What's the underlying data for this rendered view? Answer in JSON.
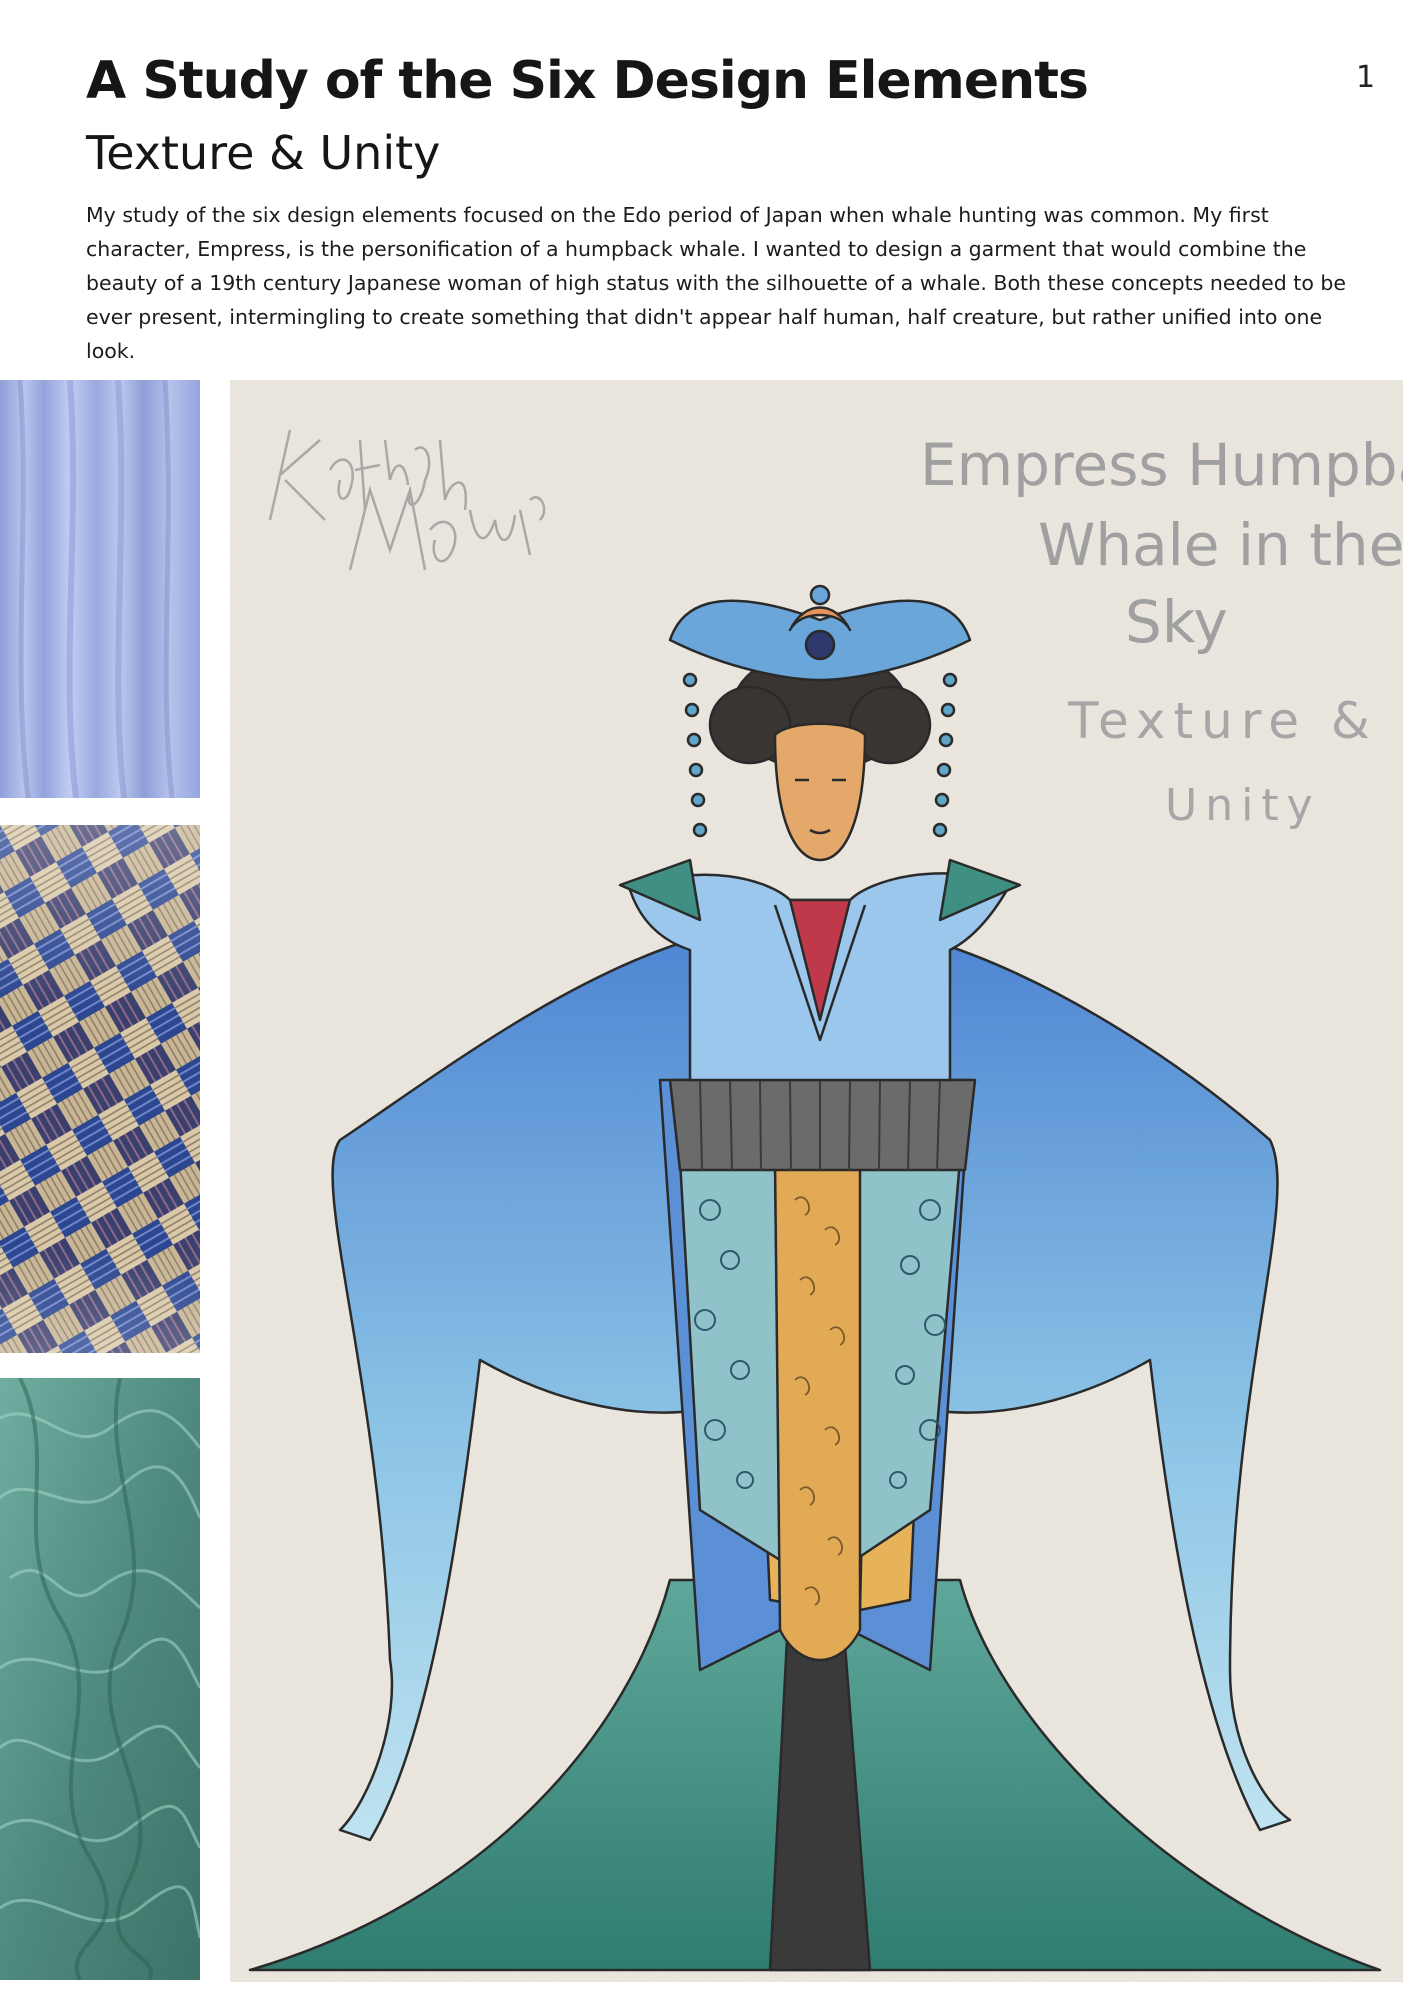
{
  "header": {
    "title": "A Study of the Six Design Elements",
    "subtitle": "Texture & Unity",
    "page_number": "1"
  },
  "intro": {
    "paragraph": "My study of the six design elements focused on the Edo period of Japan when whale hunting was common. My first character, Empress, is the personification of a humpback whale. I wanted to design a garment that would combine the beauty of a 19th century Japanese woman of high status with the silhouette of a whale. Both these concepts needed to be ever present, intermingling to create something that didn't appear half human, half creature, but rather unified into one look."
  },
  "swatches": [
    {
      "icon": "draped-fabric-swatch",
      "color": "#a9b7e6"
    },
    {
      "icon": "woven-fabric-swatch",
      "color": "#2b3f78"
    },
    {
      "icon": "chiffon-fabric-swatch",
      "color": "#5f9c8f"
    }
  ],
  "sketch": {
    "signature": "Katlyn Moum",
    "caption_lines": [
      "Empress Humpback -",
      "Whale in the",
      "Sky",
      "Texture &",
      "Unity"
    ],
    "palette": {
      "paper": "#ebe7df",
      "sleeve_blue": "#5b8fd6",
      "light_blue": "#9fd0e6",
      "teal": "#3f8f83",
      "gold": "#e6b25a",
      "ink": "#2a2a2a"
    }
  }
}
